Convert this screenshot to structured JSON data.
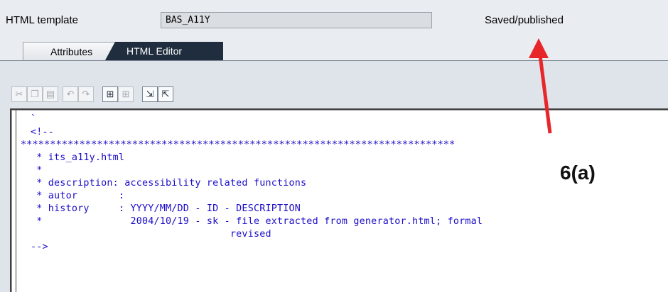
{
  "form": {
    "template_label": "HTML template",
    "template_value": "BAS_A11Y",
    "status": "Saved/published"
  },
  "tabs": [
    {
      "label": "Attributes"
    },
    {
      "label": "HTML Editor"
    }
  ],
  "toolbar": {
    "buttons": [
      {
        "icon": "cut-icon"
      },
      {
        "icon": "copy-icon"
      },
      {
        "icon": "paste-icon"
      },
      {
        "icon": "undo-icon"
      },
      {
        "icon": "redo-icon"
      },
      {
        "icon": "find-icon"
      },
      {
        "icon": "find-next-icon"
      },
      {
        "icon": "import-icon"
      },
      {
        "icon": "export-icon"
      }
    ]
  },
  "editor": {
    "lines": [
      "`",
      "<!--",
      "**************************************************************************",
      " * its_a11y.html",
      " *",
      " * description: accessibility related functions",
      " * autor       :",
      " * history     : YYYY/MM/DD - ID - DESCRIPTION",
      " *               2004/10/19 - sk - file extracted from generator.html; formal",
      "                                  revised",
      "-->"
    ]
  },
  "annotation": {
    "label": "6(a)",
    "color": "#e8262a"
  }
}
